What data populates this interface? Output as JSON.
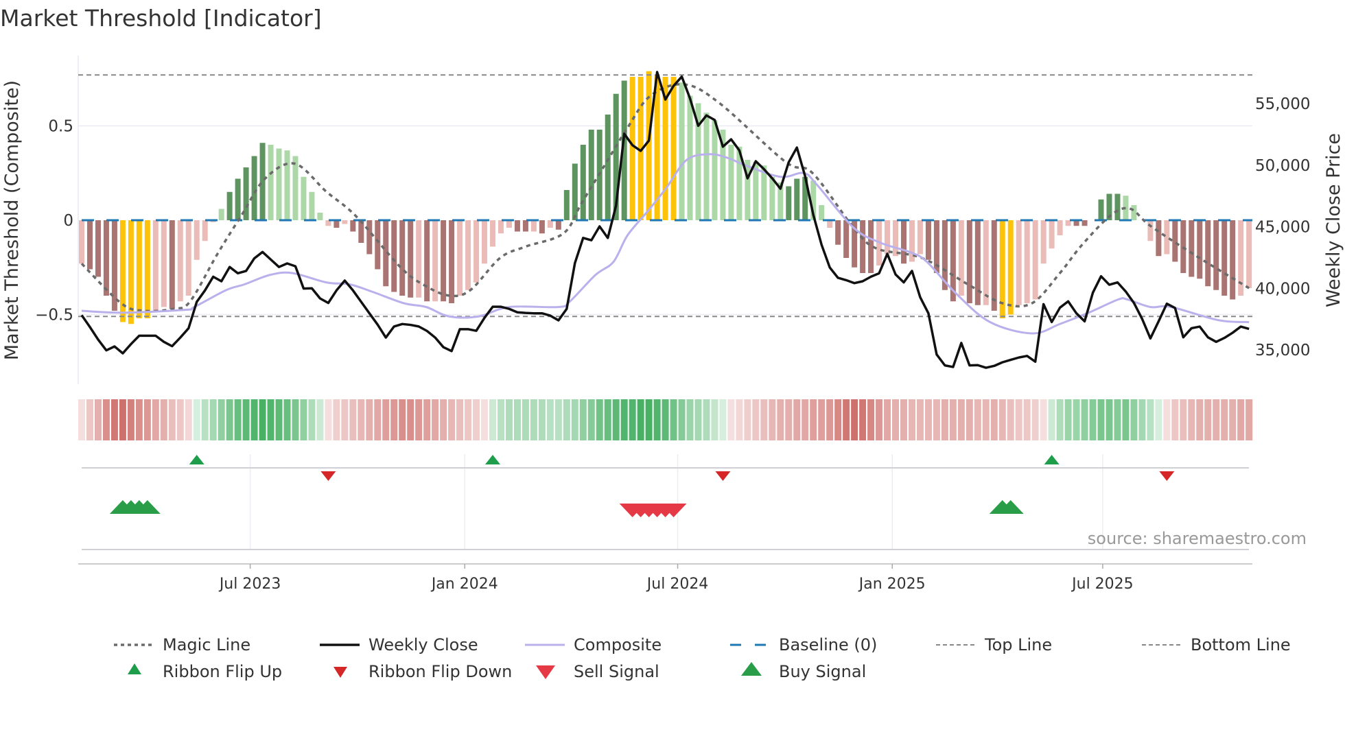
{
  "title": "Market Threshold [Indicator]",
  "source": "source: sharemaestro.com",
  "colors": {
    "hist_dark_red": "#a97471",
    "hist_light_red": "#ebbcb7",
    "hist_dark_green": "#5e9460",
    "hist_light_green": "#acd7a7",
    "hist_yellow": "#fcc30a",
    "ribbon_green": "#34a853",
    "ribbon_red": "#c9605c",
    "weekly_close": "#111111",
    "composite": "#b9b0ec",
    "magic": "#6b6b6b",
    "baseline": "#1f77b4",
    "threshold": "#888888",
    "flip_up": "#1e9e4a",
    "flip_down": "#d62728",
    "sell": "#e63946",
    "buy": "#2a9d48"
  },
  "chart_data": {
    "type": "bar+line",
    "title": "Market Threshold [Indicator]",
    "ylabel_left": "Market Threshold (Composite)",
    "ylabel_right": "Weekly Close Price",
    "ylim_left": [
      -0.87,
      0.87
    ],
    "ylim_right": [
      32000,
      60000
    ],
    "left_ticks": [
      {
        "v": 0.5,
        "label": "0.5"
      },
      {
        "v": 0,
        "label": "0"
      },
      {
        "v": -0.5,
        "label": "−0.5"
      }
    ],
    "right_ticks": [
      {
        "v": 55000,
        "label": "55,000"
      },
      {
        "v": 50000,
        "label": "50,000"
      },
      {
        "v": 45000,
        "label": "45,000"
      },
      {
        "v": 40000,
        "label": "40,000"
      },
      {
        "v": 35000,
        "label": "35,000"
      }
    ],
    "x_ticks": [
      {
        "week": 20.5,
        "label": "Jul 2023"
      },
      {
        "week": 46.6,
        "label": "Jan 2024"
      },
      {
        "week": 72.5,
        "label": "Jul 2024"
      },
      {
        "week": 98.6,
        "label": "Jan 2025"
      },
      {
        "week": 124.2,
        "label": "Jul 2025"
      }
    ],
    "top_line": 0.77,
    "bottom_line": -0.51,
    "baseline": 0,
    "histogram": {
      "values": [
        -0.23,
        -0.26,
        -0.3,
        -0.4,
        -0.48,
        -0.54,
        -0.55,
        -0.52,
        -0.52,
        -0.48,
        -0.46,
        -0.47,
        -0.43,
        -0.4,
        -0.21,
        -0.11,
        -0.01,
        0.06,
        0.15,
        0.22,
        0.28,
        0.34,
        0.41,
        0.4,
        0.38,
        0.37,
        0.34,
        0.23,
        0.15,
        0.04,
        -0.03,
        -0.04,
        -0.02,
        -0.06,
        -0.12,
        -0.18,
        -0.26,
        -0.35,
        -0.38,
        -0.4,
        -0.41,
        -0.41,
        -0.43,
        -0.43,
        -0.43,
        -0.44,
        -0.4,
        -0.37,
        -0.33,
        -0.23,
        -0.14,
        -0.07,
        -0.04,
        -0.06,
        -0.06,
        -0.06,
        -0.07,
        -0.04,
        -0.05,
        0.16,
        0.3,
        0.4,
        0.48,
        0.48,
        0.56,
        0.67,
        0.74,
        0.76,
        0.76,
        0.79,
        0.77,
        0.76,
        0.76,
        0.73,
        0.66,
        0.62,
        0.57,
        0.53,
        0.48,
        0.4,
        0.39,
        0.32,
        0.31,
        0.29,
        0.23,
        0.2,
        0.18,
        0.22,
        0.23,
        0.21,
        0.08,
        -0.04,
        -0.13,
        -0.2,
        -0.25,
        -0.28,
        -0.28,
        -0.24,
        -0.18,
        -0.19,
        -0.23,
        -0.22,
        -0.18,
        -0.21,
        -0.28,
        -0.37,
        -0.43,
        -0.4,
        -0.44,
        -0.45,
        -0.45,
        -0.48,
        -0.52,
        -0.5,
        -0.45,
        -0.44,
        -0.42,
        -0.23,
        -0.15,
        -0.08,
        -0.03,
        -0.03,
        -0.03,
        0,
        0.11,
        0.14,
        0.14,
        0.13,
        0.08,
        0,
        -0.11,
        -0.19,
        -0.18,
        -0.22,
        -0.28,
        -0.3,
        -0.31,
        -0.35,
        -0.37,
        -0.4,
        -0.42,
        -0.4,
        -0.36
      ],
      "classes": [
        "lr",
        "dr",
        "dr",
        "dr",
        "dr",
        "y",
        "y",
        "y",
        "y",
        "lr",
        "lr",
        "dr",
        "lr",
        "lr",
        "lr",
        "lr",
        "lr",
        "lg",
        "dg",
        "dg",
        "dg",
        "dg",
        "dg",
        "lg",
        "lg",
        "lg",
        "lg",
        "lg",
        "lg",
        "lg",
        "lr",
        "dr",
        "lr",
        "dr",
        "dr",
        "dr",
        "dr",
        "dr",
        "dr",
        "dr",
        "dr",
        "lr",
        "dr",
        "lr",
        "dr",
        "dr",
        "lr",
        "lr",
        "lr",
        "lr",
        "lr",
        "lr",
        "lr",
        "dr",
        "dr",
        "lr",
        "dr",
        "lr",
        "dr",
        "dg",
        "dg",
        "dg",
        "dg",
        "dg",
        "dg",
        "dg",
        "dg",
        "y",
        "y",
        "y",
        "y",
        "y",
        "y",
        "lg",
        "lg",
        "lg",
        "lg",
        "lg",
        "lg",
        "lg",
        "lg",
        "lg",
        "lg",
        "lg",
        "lg",
        "lg",
        "dg",
        "dg",
        "dg",
        "lg",
        "lg",
        "lr",
        "dr",
        "dr",
        "dr",
        "dr",
        "dr",
        "lr",
        "lr",
        "lr",
        "dr",
        "lr",
        "lr",
        "dr",
        "dr",
        "dr",
        "dr",
        "lr",
        "dr",
        "dr",
        "lr",
        "dr",
        "y",
        "y",
        "lr",
        "lr",
        "lr",
        "lr",
        "lr",
        "lr",
        "lr",
        "dr",
        "dr",
        "lr",
        "dg",
        "dg",
        "dg",
        "lg",
        "lg",
        "lr",
        "lr",
        "dr",
        "lr",
        "dr",
        "dr",
        "dr",
        "dr",
        "dr",
        "dr",
        "dr",
        "dr",
        "lr",
        "lr"
      ]
    },
    "weekly_close": [
      37820,
      36860,
      35840,
      34960,
      35280,
      34720,
      35470,
      36150,
      36150,
      36150,
      35650,
      35300,
      36000,
      36750,
      38900,
      39830,
      40940,
      40570,
      41730,
      41220,
      41410,
      42430,
      42950,
      42340,
      41730,
      42020,
      41790,
      39980,
      40000,
      39180,
      38810,
      39830,
      40630,
      39830,
      38900,
      37970,
      37050,
      36000,
      36900,
      37100,
      37030,
      36900,
      36540,
      36000,
      35220,
      34900,
      36680,
      36680,
      36550,
      37600,
      38500,
      38500,
      38330,
      38050,
      38000,
      37970,
      37970,
      37780,
      37400,
      38330,
      42050,
      44090,
      43900,
      45030,
      44090,
      46700,
      52550,
      51620,
      51160,
      52000,
      57560,
      55330,
      56440,
      57190,
      55420,
      53200,
      54040,
      53670,
      51500,
      52100,
      51200,
      48930,
      50320,
      49670,
      48930,
      48090,
      50230,
      51430,
      49110,
      45960,
      43540,
      41690,
      40850,
      40660,
      40420,
      40570,
      40940,
      41220,
      42800,
      41130,
      40480,
      41410,
      39270,
      37970,
      34630,
      33740,
      33610,
      35560,
      33740,
      33760,
      33550,
      33700,
      33990,
      34190,
      34380,
      34510,
      34040,
      38710,
      37260,
      38430,
      38940,
      37970,
      37320,
      39640,
      40980,
      40290,
      40480,
      39740,
      38810,
      37510,
      35930,
      37320,
      38750,
      38400,
      36020,
      36760,
      36890,
      36020,
      35650,
      35970,
      36390,
      36890,
      36700
    ],
    "composite": [
      [
        0,
        -0.48
      ],
      [
        5,
        -0.49
      ],
      [
        12.6,
        -0.475
      ],
      [
        13.7,
        -0.46
      ],
      [
        17.6,
        -0.37
      ],
      [
        19.8,
        -0.34
      ],
      [
        22.9,
        -0.29
      ],
      [
        25.6,
        -0.28
      ],
      [
        29.8,
        -0.33
      ],
      [
        32.6,
        -0.34
      ],
      [
        35.4,
        -0.38
      ],
      [
        39.2,
        -0.44
      ],
      [
        41.9,
        -0.46
      ],
      [
        44.7,
        -0.51
      ],
      [
        48.3,
        -0.51
      ],
      [
        52,
        -0.46
      ],
      [
        58,
        -0.46
      ],
      [
        59.4,
        -0.43
      ],
      [
        62.5,
        -0.29
      ],
      [
        64.7,
        -0.22
      ],
      [
        66.4,
        -0.08
      ],
      [
        68.9,
        0.05
      ],
      [
        71.1,
        0.17
      ],
      [
        73.6,
        0.32
      ],
      [
        76.4,
        0.35
      ],
      [
        78.6,
        0.33
      ],
      [
        80.8,
        0.29
      ],
      [
        85,
        0.23
      ],
      [
        87.8,
        0.25
      ],
      [
        89.4,
        0.19
      ],
      [
        93.9,
        -0.04
      ],
      [
        97.2,
        -0.12
      ],
      [
        100.8,
        -0.17
      ],
      [
        102.8,
        -0.22
      ],
      [
        106.4,
        -0.39
      ],
      [
        110.5,
        -0.54
      ],
      [
        115.6,
        -0.6
      ],
      [
        119,
        -0.55
      ],
      [
        122.5,
        -0.49
      ],
      [
        126.1,
        -0.42
      ],
      [
        127.2,
        -0.42
      ],
      [
        130,
        -0.46
      ],
      [
        132.5,
        -0.46
      ],
      [
        138.3,
        -0.53
      ],
      [
        142,
        -0.54
      ]
    ],
    "magic_line": [
      [
        0,
        -0.23
      ],
      [
        4.8,
        -0.44
      ],
      [
        7.6,
        -0.48
      ],
      [
        11.2,
        -0.47
      ],
      [
        13.2,
        -0.43
      ],
      [
        16.5,
        -0.18
      ],
      [
        19.5,
        0.03
      ],
      [
        22.3,
        0.22
      ],
      [
        25.9,
        0.3
      ],
      [
        29.8,
        0.15
      ],
      [
        33.4,
        0.02
      ],
      [
        38.8,
        -0.25
      ],
      [
        41.9,
        -0.35
      ],
      [
        44.8,
        -0.4
      ],
      [
        47.3,
        -0.37
      ],
      [
        50.9,
        -0.2
      ],
      [
        54,
        -0.14
      ],
      [
        58.6,
        -0.07
      ],
      [
        60.8,
        0.09
      ],
      [
        63.6,
        0.29
      ],
      [
        66.4,
        0.49
      ],
      [
        69.2,
        0.66
      ],
      [
        73.3,
        0.72
      ],
      [
        77.6,
        0.62
      ],
      [
        85.6,
        0.31
      ],
      [
        88.9,
        0.25
      ],
      [
        93.9,
        -0.04
      ],
      [
        96.7,
        -0.15
      ],
      [
        102.2,
        -0.2
      ],
      [
        107.8,
        -0.34
      ],
      [
        112,
        -0.44
      ],
      [
        115.6,
        -0.44
      ],
      [
        119,
        -0.28
      ],
      [
        121.7,
        -0.13
      ],
      [
        125.3,
        0.03
      ],
      [
        127.6,
        0.06
      ],
      [
        130,
        -0.03
      ],
      [
        135.6,
        -0.19
      ],
      [
        142,
        -0.36
      ]
    ],
    "ribbon": [
      -0.15,
      -0.3,
      -0.45,
      -0.65,
      -0.8,
      -0.85,
      -0.75,
      -0.65,
      -0.6,
      -0.5,
      -0.45,
      -0.35,
      -0.3,
      -0.2,
      0.15,
      0.3,
      0.4,
      0.5,
      0.6,
      0.7,
      0.75,
      0.8,
      0.85,
      0.8,
      0.75,
      0.7,
      0.6,
      0.5,
      0.35,
      0.2,
      -0.15,
      -0.25,
      -0.3,
      -0.35,
      -0.4,
      -0.45,
      -0.5,
      -0.55,
      -0.6,
      -0.65,
      -0.65,
      -0.6,
      -0.55,
      -0.5,
      -0.45,
      -0.4,
      -0.35,
      -0.3,
      -0.25,
      -0.15,
      0.2,
      0.3,
      0.35,
      0.35,
      0.35,
      0.35,
      0.35,
      0.3,
      0.3,
      0.35,
      0.4,
      0.5,
      0.55,
      0.65,
      0.7,
      0.75,
      0.8,
      0.8,
      0.85,
      0.85,
      0.8,
      0.75,
      0.65,
      0.55,
      0.45,
      0.4,
      0.35,
      0.25,
      0.15,
      -0.15,
      -0.2,
      -0.25,
      -0.3,
      -0.35,
      -0.4,
      -0.45,
      -0.45,
      -0.5,
      -0.5,
      -0.55,
      -0.55,
      -0.6,
      -0.7,
      -0.8,
      -0.85,
      -0.8,
      -0.7,
      -0.6,
      -0.5,
      -0.45,
      -0.45,
      -0.4,
      -0.4,
      -0.4,
      -0.4,
      -0.45,
      -0.45,
      -0.45,
      -0.45,
      -0.4,
      -0.4,
      -0.45,
      -0.4,
      -0.35,
      -0.3,
      -0.3,
      -0.25,
      -0.15,
      0.2,
      0.35,
      0.45,
      0.45,
      0.5,
      0.55,
      0.6,
      0.6,
      0.55,
      0.6,
      0.5,
      0.4,
      0.3,
      0.15,
      -0.15,
      -0.3,
      -0.35,
      -0.4,
      -0.45,
      -0.45,
      -0.45,
      -0.45,
      -0.45,
      -0.5,
      -0.5
    ],
    "ribbon_flip_up_weeks": [
      14,
      50,
      118
    ],
    "ribbon_flip_down_weeks": [
      30,
      78,
      132
    ],
    "buy_signal_weeks": [
      5,
      6,
      7,
      8,
      112,
      113
    ],
    "sell_signal_weeks": [
      67,
      68,
      69,
      70,
      71,
      72
    ],
    "legend": {
      "placement": "bottom",
      "items": [
        {
          "key": "magic",
          "label": "Magic Line"
        },
        {
          "key": "close",
          "label": "Weekly Close"
        },
        {
          "key": "composite",
          "label": "Composite"
        },
        {
          "key": "baseline",
          "label": "Baseline (0)"
        },
        {
          "key": "top",
          "label": "Top Line"
        },
        {
          "key": "bottom",
          "label": "Bottom Line"
        },
        {
          "key": "flipup",
          "label": "Ribbon Flip Up"
        },
        {
          "key": "flipdown",
          "label": "Ribbon Flip Down"
        },
        {
          "key": "sell",
          "label": "Sell Signal"
        },
        {
          "key": "buy",
          "label": "Buy Signal"
        }
      ]
    }
  }
}
